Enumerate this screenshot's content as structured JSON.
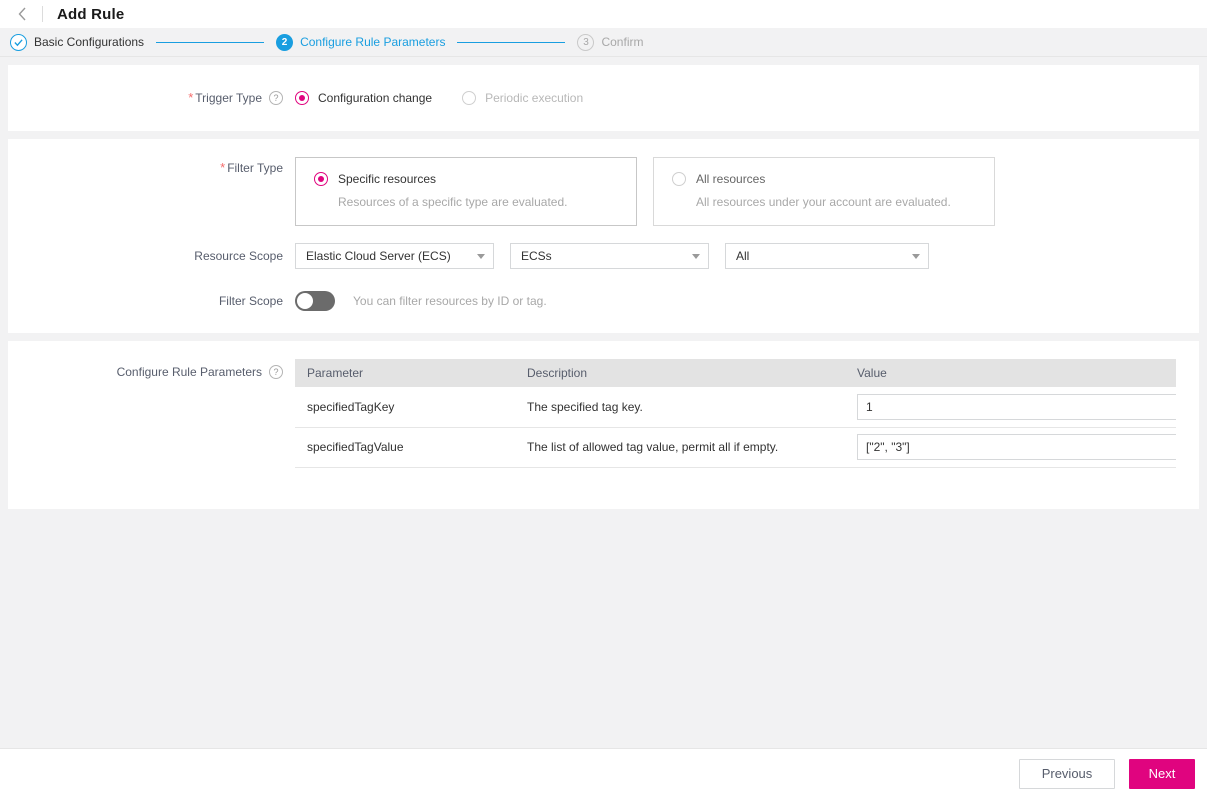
{
  "header": {
    "back_icon": "chevron-left-icon",
    "title": "Add Rule"
  },
  "steps": [
    {
      "index": "1",
      "label": "Basic Configurations",
      "state": "done",
      "mark": "check-icon"
    },
    {
      "index": "2",
      "label": "Configure Rule Parameters",
      "state": "active",
      "mark": "2"
    },
    {
      "index": "3",
      "label": "Confirm",
      "state": "todo",
      "mark": "3"
    }
  ],
  "colors": {
    "step_active": "#199ee0",
    "accent_magenta": "#e0047f",
    "required_star": "#f56c6c",
    "page_bg": "#f2f2f3",
    "table_header_bg": "#e3e3e3"
  },
  "trigger_type": {
    "label": "Trigger Type",
    "required": "*",
    "help_icon": "help-circle-icon",
    "options": [
      {
        "label": "Configuration change",
        "selected": true,
        "disabled": false
      },
      {
        "label": "Periodic execution",
        "selected": false,
        "disabled": true
      }
    ]
  },
  "filter_type": {
    "label": "Filter Type",
    "required": "*",
    "options": [
      {
        "title": "Specific resources",
        "subtitle": "Resources of a specific type are evaluated.",
        "selected": true
      },
      {
        "title": "All resources",
        "subtitle": "All resources under your account are evaluated.",
        "selected": false
      }
    ]
  },
  "resource_scope": {
    "label": "Resource Scope",
    "selects": [
      {
        "name": "provider",
        "value": "Elastic Cloud Server (ECS)"
      },
      {
        "name": "resource-type",
        "value": "ECSs"
      },
      {
        "name": "region",
        "value": "All"
      }
    ]
  },
  "filter_scope": {
    "label": "Filter Scope",
    "toggle_on": false,
    "hint": "You can filter resources by ID or tag."
  },
  "configure_rule_parameters": {
    "label": "Configure Rule Parameters",
    "help_icon": "help-circle-icon",
    "columns": [
      "Parameter",
      "Description",
      "Value"
    ],
    "rows": [
      {
        "parameter": "specifiedTagKey",
        "description": "The specified tag key.",
        "value": "1"
      },
      {
        "parameter": "specifiedTagValue",
        "description": "The list of allowed tag value, permit all if empty.",
        "value": "[\"2\", \"3\"]"
      }
    ]
  },
  "footer": {
    "previous_label": "Previous",
    "next_label": "Next"
  }
}
